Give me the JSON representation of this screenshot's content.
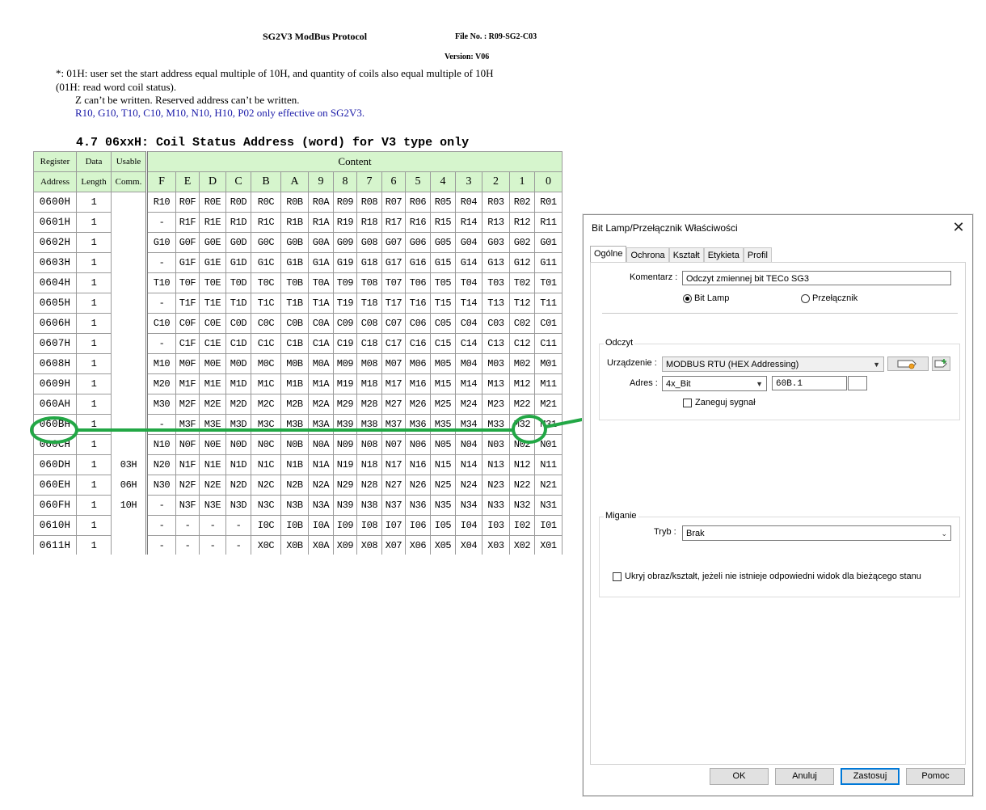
{
  "document": {
    "title": "SG2V3 ModBus Protocol",
    "file_no": "File No. : R09-SG2-C03",
    "version": "Version: V06",
    "notes": [
      "*: 01H: user set the start address equal multiple of 10H, and quantity of coils also equal multiple of 10H",
      "(01H: read word coil status).",
      "Z can’t be written. Reserved address can’t be written.",
      "R10, G10, T10, C10, M10, N10, H10, P02 only effective on SG2V3."
    ],
    "section_heading": "4.7 06xxH: Coil Status Address (word) for V3 type only",
    "table": {
      "headers": {
        "register_top": "Register",
        "register_bottom": "Address",
        "data_top": "Data",
        "data_bottom": "Length",
        "usable_top": "Usable",
        "usable_bottom": "Comm.",
        "content": "Content",
        "bits": [
          "F",
          "E",
          "D",
          "C",
          "B",
          "A",
          "9",
          "8",
          "7",
          "6",
          "5",
          "4",
          "3",
          "2",
          "1",
          "0"
        ]
      },
      "usable_comm": [
        "03H",
        "06H",
        "10H"
      ],
      "rows": [
        {
          "addr": "0600H",
          "len": "1",
          "bits": [
            "R10",
            "R0F",
            "R0E",
            "R0D",
            "R0C",
            "R0B",
            "R0A",
            "R09",
            "R08",
            "R07",
            "R06",
            "R05",
            "R04",
            "R03",
            "R02",
            "R01"
          ]
        },
        {
          "addr": "0601H",
          "len": "1",
          "bits": [
            "-",
            "R1F",
            "R1E",
            "R1D",
            "R1C",
            "R1B",
            "R1A",
            "R19",
            "R18",
            "R17",
            "R16",
            "R15",
            "R14",
            "R13",
            "R12",
            "R11"
          ]
        },
        {
          "addr": "0602H",
          "len": "1",
          "bits": [
            "G10",
            "G0F",
            "G0E",
            "G0D",
            "G0C",
            "G0B",
            "G0A",
            "G09",
            "G08",
            "G07",
            "G06",
            "G05",
            "G04",
            "G03",
            "G02",
            "G01"
          ]
        },
        {
          "addr": "0603H",
          "len": "1",
          "bits": [
            "-",
            "G1F",
            "G1E",
            "G1D",
            "G1C",
            "G1B",
            "G1A",
            "G19",
            "G18",
            "G17",
            "G16",
            "G15",
            "G14",
            "G13",
            "G12",
            "G11"
          ]
        },
        {
          "addr": "0604H",
          "len": "1",
          "bits": [
            "T10",
            "T0F",
            "T0E",
            "T0D",
            "T0C",
            "T0B",
            "T0A",
            "T09",
            "T08",
            "T07",
            "T06",
            "T05",
            "T04",
            "T03",
            "T02",
            "T01"
          ]
        },
        {
          "addr": "0605H",
          "len": "1",
          "bits": [
            "-",
            "T1F",
            "T1E",
            "T1D",
            "T1C",
            "T1B",
            "T1A",
            "T19",
            "T18",
            "T17",
            "T16",
            "T15",
            "T14",
            "T13",
            "T12",
            "T11"
          ]
        },
        {
          "addr": "0606H",
          "len": "1",
          "bits": [
            "C10",
            "C0F",
            "C0E",
            "C0D",
            "C0C",
            "C0B",
            "C0A",
            "C09",
            "C08",
            "C07",
            "C06",
            "C05",
            "C04",
            "C03",
            "C02",
            "C01"
          ]
        },
        {
          "addr": "0607H",
          "len": "1",
          "bits": [
            "-",
            "C1F",
            "C1E",
            "C1D",
            "C1C",
            "C1B",
            "C1A",
            "C19",
            "C18",
            "C17",
            "C16",
            "C15",
            "C14",
            "C13",
            "C12",
            "C11"
          ]
        },
        {
          "addr": "0608H",
          "len": "1",
          "bits": [
            "M10",
            "M0F",
            "M0E",
            "M0D",
            "M0C",
            "M0B",
            "M0A",
            "M09",
            "M08",
            "M07",
            "M06",
            "M05",
            "M04",
            "M03",
            "M02",
            "M01"
          ]
        },
        {
          "addr": "0609H",
          "len": "1",
          "bits": [
            "M20",
            "M1F",
            "M1E",
            "M1D",
            "M1C",
            "M1B",
            "M1A",
            "M19",
            "M18",
            "M17",
            "M16",
            "M15",
            "M14",
            "M13",
            "M12",
            "M11"
          ]
        },
        {
          "addr": "060AH",
          "len": "1",
          "bits": [
            "M30",
            "M2F",
            "M2E",
            "M2D",
            "M2C",
            "M2B",
            "M2A",
            "M29",
            "M28",
            "M27",
            "M26",
            "M25",
            "M24",
            "M23",
            "M22",
            "M21"
          ]
        },
        {
          "addr": "060BH",
          "len": "1",
          "bits": [
            "-",
            "M3F",
            "M3E",
            "M3D",
            "M3C",
            "M3B",
            "M3A",
            "M39",
            "M38",
            "M37",
            "M36",
            "M35",
            "M34",
            "M33",
            "M32",
            "M31"
          ]
        },
        {
          "addr": "060CH",
          "len": "1",
          "bits": [
            "N10",
            "N0F",
            "N0E",
            "N0D",
            "N0C",
            "N0B",
            "N0A",
            "N09",
            "N08",
            "N07",
            "N06",
            "N05",
            "N04",
            "N03",
            "N02",
            "N01"
          ]
        },
        {
          "addr": "060DH",
          "len": "1",
          "bits": [
            "N20",
            "N1F",
            "N1E",
            "N1D",
            "N1C",
            "N1B",
            "N1A",
            "N19",
            "N18",
            "N17",
            "N16",
            "N15",
            "N14",
            "N13",
            "N12",
            "N11"
          ]
        },
        {
          "addr": "060EH",
          "len": "1",
          "bits": [
            "N30",
            "N2F",
            "N2E",
            "N2D",
            "N2C",
            "N2B",
            "N2A",
            "N29",
            "N28",
            "N27",
            "N26",
            "N25",
            "N24",
            "N23",
            "N22",
            "N21"
          ]
        },
        {
          "addr": "060FH",
          "len": "1",
          "bits": [
            "-",
            "N3F",
            "N3E",
            "N3D",
            "N3C",
            "N3B",
            "N3A",
            "N39",
            "N38",
            "N37",
            "N36",
            "N35",
            "N34",
            "N33",
            "N32",
            "N31"
          ]
        },
        {
          "addr": "0610H",
          "len": "1",
          "bits": [
            "-",
            "-",
            "-",
            "-",
            "I0C",
            "I0B",
            "I0A",
            "I09",
            "I08",
            "I07",
            "I06",
            "I05",
            "I04",
            "I03",
            "I02",
            "I01"
          ]
        },
        {
          "addr": "0611H",
          "len": "1",
          "bits": [
            "-",
            "-",
            "-",
            "-",
            "X0C",
            "X0B",
            "X0A",
            "X09",
            "X08",
            "X07",
            "X06",
            "X05",
            "X04",
            "X03",
            "X02",
            "X01"
          ]
        }
      ]
    }
  },
  "annotation": {
    "color": "#22a745"
  },
  "dialog": {
    "title": "Bit Lamp/Przełącznik Właściwości",
    "close_glyph": "✕",
    "tabs": [
      "Ogólne",
      "Ochrona",
      "Kształt",
      "Etykieta",
      "Profil"
    ],
    "active_tab": "Ogólne",
    "komentarz_label": "Komentarz :",
    "komentarz_value": "Odczyt zmiennej bit TECo SG3",
    "radio_bit_lamp": "Bit Lamp",
    "radio_przelacznik": "Przełącznik",
    "odczyt_title": "Odczyt",
    "urzadzenie_label": "Urządzenie :",
    "urzadzenie_value": "MODBUS RTU (HEX Addressing)",
    "adres_label": "Adres :",
    "adres_type": "4x_Bit",
    "adres_value": "60B.1",
    "zaneguj_label": "Zaneguj sygnał",
    "miganie_title": "Miganie",
    "tryb_label": "Tryb :",
    "tryb_value": "Brak",
    "ukryj_label": "Ukryj obraz/kształt, jeżeli nie istnieje odpowiedni widok dla bieżącego stanu",
    "buttons": {
      "ok": "OK",
      "cancel": "Anuluj",
      "apply": "Zastosuj",
      "help": "Pomoc"
    }
  }
}
